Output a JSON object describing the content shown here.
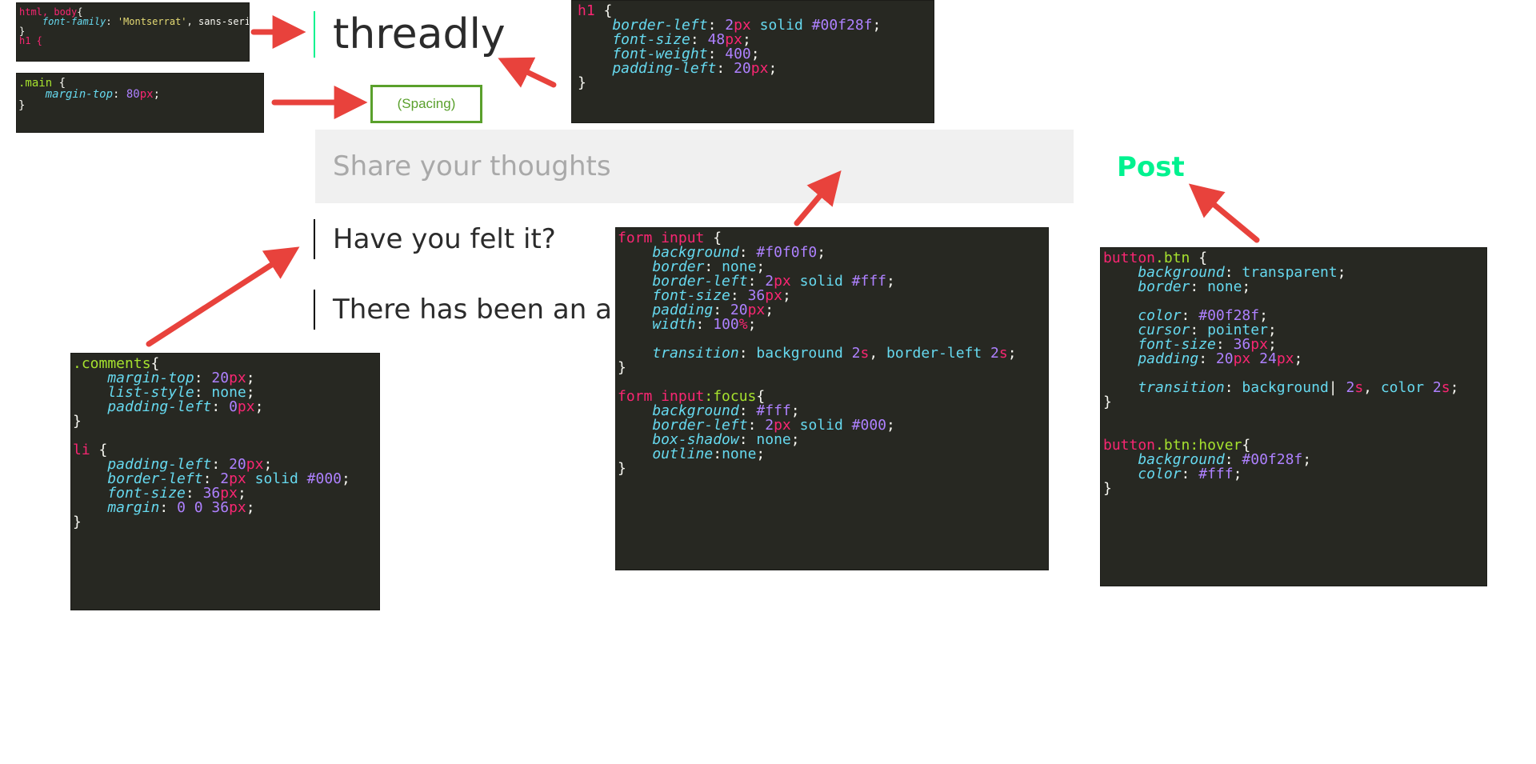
{
  "page": {
    "title": "threadly",
    "spacing_label": "(Spacing)",
    "input_placeholder": "Share your thoughts",
    "post_label": "Post",
    "comments": [
      "Have you felt it?",
      "There has been an a"
    ]
  },
  "colors": {
    "accent": "#00f28f",
    "input_bg": "#f0f0f0",
    "arrow": "#e8423c",
    "spacing_border": "#5aa02c",
    "code_bg": "#272822"
  },
  "code_html_body": [
    [
      [
        "html, body",
        "t-sel"
      ],
      [
        "{",
        "t-pun"
      ]
    ],
    [
      [
        "    font-family",
        "t-prop"
      ],
      [
        ": ",
        "t-pun"
      ],
      [
        "'Montserrat'",
        "t-str"
      ],
      [
        ", sans-serif;",
        "t-pun"
      ]
    ],
    [
      [
        "}",
        "t-pun"
      ]
    ],
    [
      [
        "h1 {",
        "t-sel"
      ]
    ]
  ],
  "code_main": [
    [
      [
        ".main",
        "t-cls"
      ],
      [
        " {",
        "t-pun"
      ]
    ],
    [
      [
        "    margin-top",
        "t-prop"
      ],
      [
        ": ",
        "t-pun"
      ],
      [
        "80",
        "t-num"
      ],
      [
        "px",
        "t-unit"
      ],
      [
        ";",
        "t-pun"
      ]
    ],
    [
      [
        "}",
        "t-pun"
      ]
    ]
  ],
  "code_h1": [
    [
      [
        "h1",
        "t-sel"
      ],
      [
        " {",
        "t-pun"
      ]
    ],
    [
      [
        "    border-left",
        "t-prop"
      ],
      [
        ": ",
        "t-pun"
      ],
      [
        "2",
        "t-num"
      ],
      [
        "px",
        "t-unit"
      ],
      [
        " solid ",
        "t-val"
      ],
      [
        "#00f28f",
        "t-num"
      ],
      [
        ";",
        "t-pun"
      ]
    ],
    [
      [
        "    font-size",
        "t-prop"
      ],
      [
        ": ",
        "t-pun"
      ],
      [
        "48",
        "t-num"
      ],
      [
        "px",
        "t-unit"
      ],
      [
        ";",
        "t-pun"
      ]
    ],
    [
      [
        "    font-weight",
        "t-prop"
      ],
      [
        ": ",
        "t-pun"
      ],
      [
        "400",
        "t-num"
      ],
      [
        ";",
        "t-pun"
      ]
    ],
    [
      [
        "    padding-left",
        "t-prop"
      ],
      [
        ": ",
        "t-pun"
      ],
      [
        "20",
        "t-num"
      ],
      [
        "px",
        "t-unit"
      ],
      [
        ";",
        "t-pun"
      ]
    ],
    [
      [
        "}",
        "t-pun"
      ]
    ]
  ],
  "code_comments": [
    [
      [
        ".comments",
        "t-cls"
      ],
      [
        "{",
        "t-pun"
      ]
    ],
    [
      [
        "    margin-top",
        "t-prop"
      ],
      [
        ": ",
        "t-pun"
      ],
      [
        "20",
        "t-num"
      ],
      [
        "px",
        "t-unit"
      ],
      [
        ";",
        "t-pun"
      ]
    ],
    [
      [
        "    list-style",
        "t-prop"
      ],
      [
        ": ",
        "t-pun"
      ],
      [
        "none",
        "t-val"
      ],
      [
        ";",
        "t-pun"
      ]
    ],
    [
      [
        "    padding-left",
        "t-prop"
      ],
      [
        ": ",
        "t-pun"
      ],
      [
        "0",
        "t-num"
      ],
      [
        "px",
        "t-unit"
      ],
      [
        ";",
        "t-pun"
      ]
    ],
    [
      [
        "}",
        "t-pun"
      ]
    ],
    [
      [
        "",
        "t-pun"
      ]
    ],
    [
      [
        "li",
        "t-sel"
      ],
      [
        " {",
        "t-pun"
      ]
    ],
    [
      [
        "    padding-left",
        "t-prop"
      ],
      [
        ": ",
        "t-pun"
      ],
      [
        "20",
        "t-num"
      ],
      [
        "px",
        "t-unit"
      ],
      [
        ";",
        "t-pun"
      ]
    ],
    [
      [
        "    border-left",
        "t-prop"
      ],
      [
        ": ",
        "t-pun"
      ],
      [
        "2",
        "t-num"
      ],
      [
        "px",
        "t-unit"
      ],
      [
        " solid ",
        "t-val"
      ],
      [
        "#000",
        "t-num"
      ],
      [
        ";",
        "t-pun"
      ]
    ],
    [
      [
        "    font-size",
        "t-prop"
      ],
      [
        ": ",
        "t-pun"
      ],
      [
        "36",
        "t-num"
      ],
      [
        "px",
        "t-unit"
      ],
      [
        ";",
        "t-pun"
      ]
    ],
    [
      [
        "    margin",
        "t-prop"
      ],
      [
        ": ",
        "t-pun"
      ],
      [
        "0 0 36",
        "t-num"
      ],
      [
        "px",
        "t-unit"
      ],
      [
        ";",
        "t-pun"
      ]
    ],
    [
      [
        "}",
        "t-pun"
      ]
    ]
  ],
  "code_form_input": [
    [
      [
        "form input",
        "t-sel"
      ],
      [
        " {",
        "t-pun"
      ]
    ],
    [
      [
        "    background",
        "t-prop"
      ],
      [
        ": ",
        "t-pun"
      ],
      [
        "#f0f0f0",
        "t-num"
      ],
      [
        ";",
        "t-pun"
      ]
    ],
    [
      [
        "    border",
        "t-prop"
      ],
      [
        ": ",
        "t-pun"
      ],
      [
        "none",
        "t-val"
      ],
      [
        ";",
        "t-pun"
      ]
    ],
    [
      [
        "    border-left",
        "t-prop"
      ],
      [
        ": ",
        "t-pun"
      ],
      [
        "2",
        "t-num"
      ],
      [
        "px",
        "t-unit"
      ],
      [
        " solid ",
        "t-val"
      ],
      [
        "#fff",
        "t-num"
      ],
      [
        ";",
        "t-pun"
      ]
    ],
    [
      [
        "    font-size",
        "t-prop"
      ],
      [
        ": ",
        "t-pun"
      ],
      [
        "36",
        "t-num"
      ],
      [
        "px",
        "t-unit"
      ],
      [
        ";",
        "t-pun"
      ]
    ],
    [
      [
        "    padding",
        "t-prop"
      ],
      [
        ": ",
        "t-pun"
      ],
      [
        "20",
        "t-num"
      ],
      [
        "px",
        "t-unit"
      ],
      [
        ";",
        "t-pun"
      ]
    ],
    [
      [
        "    width",
        "t-prop"
      ],
      [
        ": ",
        "t-pun"
      ],
      [
        "100",
        "t-num"
      ],
      [
        "%",
        "t-unit"
      ],
      [
        ";",
        "t-pun"
      ]
    ],
    [
      [
        "",
        "t-pun"
      ]
    ],
    [
      [
        "    transition",
        "t-prop"
      ],
      [
        ": ",
        "t-pun"
      ],
      [
        "background ",
        "t-val"
      ],
      [
        "2",
        "t-num"
      ],
      [
        "s",
        "t-unit"
      ],
      [
        ", ",
        "t-pun"
      ],
      [
        "border-left ",
        "t-val"
      ],
      [
        "2",
        "t-num"
      ],
      [
        "s",
        "t-unit"
      ],
      [
        ";",
        "t-pun"
      ]
    ],
    [
      [
        "}",
        "t-pun"
      ]
    ],
    [
      [
        "",
        "t-pun"
      ]
    ],
    [
      [
        "form input",
        "t-sel"
      ],
      [
        ":focus",
        "t-cls"
      ],
      [
        "{",
        "t-pun"
      ]
    ],
    [
      [
        "    background",
        "t-prop"
      ],
      [
        ": ",
        "t-pun"
      ],
      [
        "#fff",
        "t-num"
      ],
      [
        ";",
        "t-pun"
      ]
    ],
    [
      [
        "    border-left",
        "t-prop"
      ],
      [
        ": ",
        "t-pun"
      ],
      [
        "2",
        "t-num"
      ],
      [
        "px",
        "t-unit"
      ],
      [
        " solid ",
        "t-val"
      ],
      [
        "#000",
        "t-num"
      ],
      [
        ";",
        "t-pun"
      ]
    ],
    [
      [
        "    box-shadow",
        "t-prop"
      ],
      [
        ": ",
        "t-pun"
      ],
      [
        "none",
        "t-val"
      ],
      [
        ";",
        "t-pun"
      ]
    ],
    [
      [
        "    outline",
        "t-prop"
      ],
      [
        ":",
        "t-pun"
      ],
      [
        "none",
        "t-val"
      ],
      [
        ";",
        "t-pun"
      ]
    ],
    [
      [
        "}",
        "t-pun"
      ]
    ]
  ],
  "code_button": [
    [
      [
        "button",
        "t-sel"
      ],
      [
        ".btn",
        "t-cls"
      ],
      [
        " {",
        "t-pun"
      ]
    ],
    [
      [
        "    background",
        "t-prop"
      ],
      [
        ": ",
        "t-pun"
      ],
      [
        "transparent",
        "t-val"
      ],
      [
        ";",
        "t-pun"
      ]
    ],
    [
      [
        "    border",
        "t-prop"
      ],
      [
        ": ",
        "t-pun"
      ],
      [
        "none",
        "t-val"
      ],
      [
        ";",
        "t-pun"
      ]
    ],
    [
      [
        "",
        "t-pun"
      ]
    ],
    [
      [
        "    color",
        "t-prop"
      ],
      [
        ": ",
        "t-pun"
      ],
      [
        "#00f28f",
        "t-num"
      ],
      [
        ";",
        "t-pun"
      ]
    ],
    [
      [
        "    cursor",
        "t-prop"
      ],
      [
        ": ",
        "t-pun"
      ],
      [
        "pointer",
        "t-val"
      ],
      [
        ";",
        "t-pun"
      ]
    ],
    [
      [
        "    font-size",
        "t-prop"
      ],
      [
        ": ",
        "t-pun"
      ],
      [
        "36",
        "t-num"
      ],
      [
        "px",
        "t-unit"
      ],
      [
        ";",
        "t-pun"
      ]
    ],
    [
      [
        "    padding",
        "t-prop"
      ],
      [
        ": ",
        "t-pun"
      ],
      [
        "20",
        "t-num"
      ],
      [
        "px",
        "t-unit"
      ],
      [
        " ",
        "t-pun"
      ],
      [
        "24",
        "t-num"
      ],
      [
        "px",
        "t-unit"
      ],
      [
        ";",
        "t-pun"
      ]
    ],
    [
      [
        "",
        "t-pun"
      ]
    ],
    [
      [
        "    transition",
        "t-prop"
      ],
      [
        ": ",
        "t-pun"
      ],
      [
        "background",
        "t-val"
      ],
      [
        "| ",
        "t-pun"
      ],
      [
        "2",
        "t-num"
      ],
      [
        "s",
        "t-unit"
      ],
      [
        ", ",
        "t-pun"
      ],
      [
        "color ",
        "t-val"
      ],
      [
        "2",
        "t-num"
      ],
      [
        "s",
        "t-unit"
      ],
      [
        ";",
        "t-pun"
      ]
    ],
    [
      [
        "}",
        "t-pun"
      ]
    ],
    [
      [
        "",
        "t-pun"
      ]
    ],
    [
      [
        "",
        "t-pun"
      ]
    ],
    [
      [
        "button",
        "t-sel"
      ],
      [
        ".btn",
        "t-cls"
      ],
      [
        ":hover",
        "t-cls"
      ],
      [
        "{",
        "t-pun"
      ]
    ],
    [
      [
        "    background",
        "t-prop"
      ],
      [
        ": ",
        "t-pun"
      ],
      [
        "#00f28f",
        "t-num"
      ],
      [
        ";",
        "t-pun"
      ]
    ],
    [
      [
        "    color",
        "t-prop"
      ],
      [
        ": ",
        "t-pun"
      ],
      [
        "#fff",
        "t-num"
      ],
      [
        ";",
        "t-pun"
      ]
    ],
    [
      [
        "}",
        "t-pun"
      ]
    ]
  ]
}
